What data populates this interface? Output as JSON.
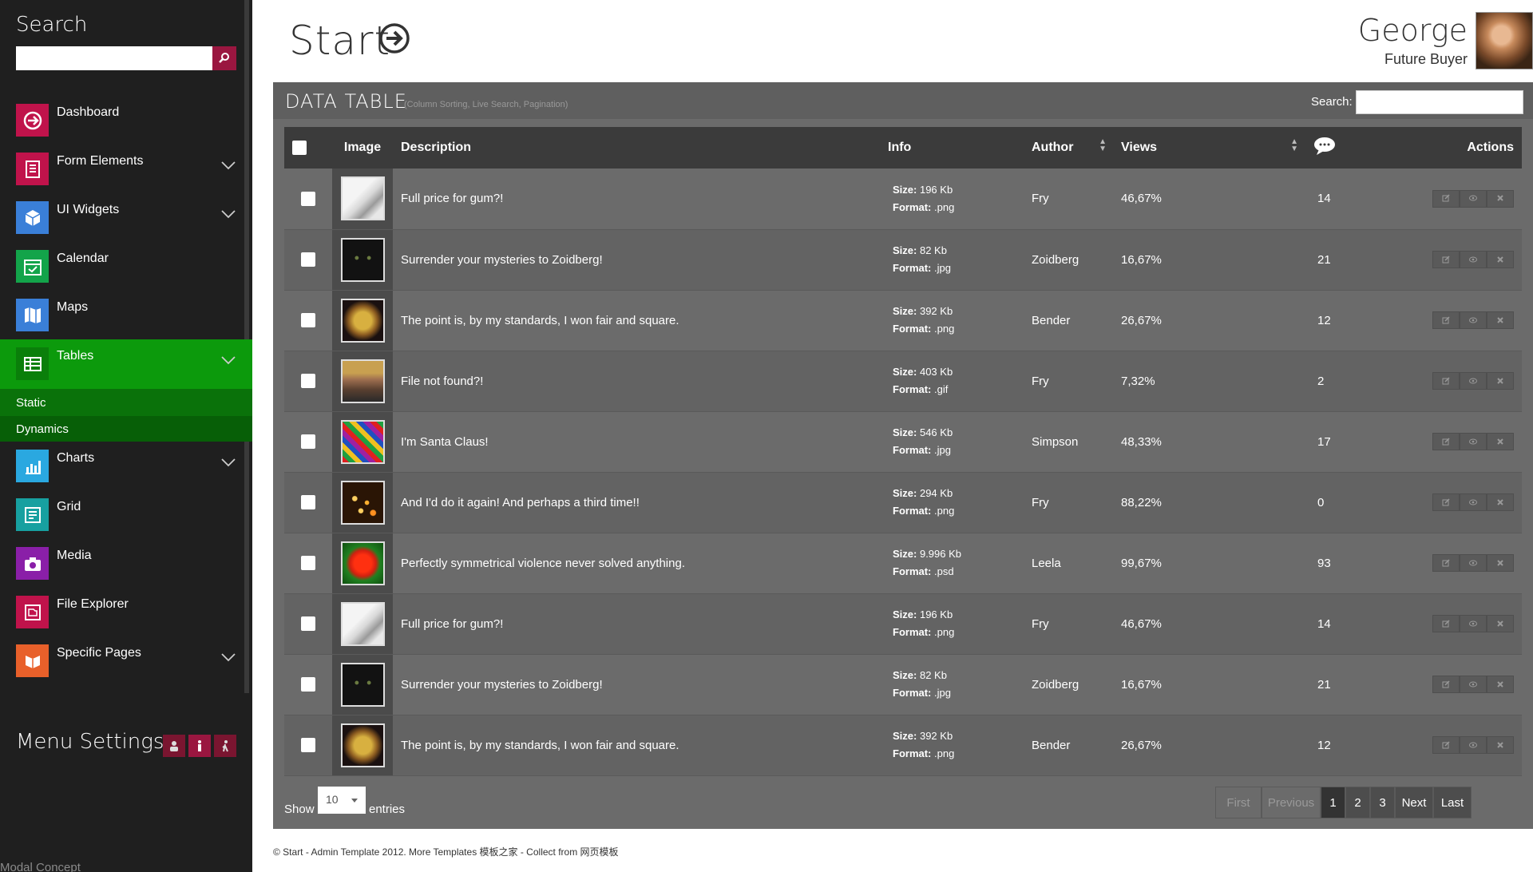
{
  "sidebar": {
    "search_label": "Search",
    "search_placeholder": "",
    "items": [
      {
        "label": "Dashboard",
        "color": "#c0134b",
        "icon": "arrow-circle-icon"
      },
      {
        "label": "Form Elements",
        "color": "#c0134b",
        "icon": "form-icon"
      },
      {
        "label": "UI Widgets",
        "color": "#3a7fd8",
        "icon": "cube-icon"
      },
      {
        "label": "Calendar",
        "color": "#13a44a",
        "icon": "calendar-icon"
      },
      {
        "label": "Maps",
        "color": "#3a7fd8",
        "icon": "map-icon"
      },
      {
        "label": "Tables",
        "color": "#0c9a0c",
        "icon": "table-icon"
      },
      {
        "label": "Charts",
        "color": "#2aa8e0",
        "icon": "chart-icon"
      },
      {
        "label": "Grid",
        "color": "#17a0a0",
        "icon": "grid-icon"
      },
      {
        "label": "Media",
        "color": "#8a1fa8",
        "icon": "camera-icon"
      },
      {
        "label": "File Explorer",
        "color": "#c0134b",
        "icon": "folder-icon"
      },
      {
        "label": "Specific Pages",
        "color": "#e8602a",
        "icon": "book-icon"
      }
    ],
    "sub_items": [
      "Static",
      "Dynamics"
    ],
    "menu_settings": "Menu Settings",
    "modal_concept": "Modal Concept"
  },
  "header": {
    "title": "Start",
    "user_name": "George",
    "user_role": "Future Buyer"
  },
  "panel": {
    "title": "DATA TABLE",
    "subtitle": "(Column Sorting, Live Search, Pagination)",
    "search_label": "Search:",
    "columns": [
      "Image",
      "Description",
      "Info",
      "Author",
      "Views",
      "Actions"
    ],
    "size_label": "Size:",
    "format_label": "Format:",
    "rows": [
      {
        "desc": "Full price for gum?!",
        "size": "196 Kb",
        "format": ".png",
        "author": "Fry",
        "views": "46,67%",
        "comments": "14",
        "thumb": "cat"
      },
      {
        "desc": "Surrender your mysteries to Zoidberg!",
        "size": "82 Kb",
        "format": ".jpg",
        "author": "Zoidberg",
        "views": "16,67%",
        "comments": "21",
        "thumb": "blackcat"
      },
      {
        "desc": "The point is, by my standards, I won fair and square.",
        "size": "392 Kb",
        "format": ".png",
        "author": "Bender",
        "views": "26,67%",
        "comments": "12",
        "thumb": "mask"
      },
      {
        "desc": "File not found?!",
        "size": "403 Kb",
        "format": ".gif",
        "author": "Fry",
        "views": "7,32%",
        "comments": "2",
        "thumb": "man"
      },
      {
        "desc": "I'm Santa Claus!",
        "size": "546 Kb",
        "format": ".jpg",
        "author": "Simpson",
        "views": "48,33%",
        "comments": "17",
        "thumb": "crayons"
      },
      {
        "desc": "And I'd do it again! And perhaps a third time!!",
        "size": "294 Kb",
        "format": ".png",
        "author": "Fry",
        "views": "88,22%",
        "comments": "0",
        "thumb": "candles"
      },
      {
        "desc": "Perfectly symmetrical violence never solved anything.",
        "size": "9.996 Kb",
        "format": ".psd",
        "author": "Leela",
        "views": "99,67%",
        "comments": "93",
        "thumb": "flower"
      },
      {
        "desc": "Full price for gum?!",
        "size": "196 Kb",
        "format": ".png",
        "author": "Fry",
        "views": "46,67%",
        "comments": "14",
        "thumb": "cat"
      },
      {
        "desc": "Surrender your mysteries to Zoidberg!",
        "size": "82 Kb",
        "format": ".jpg",
        "author": "Zoidberg",
        "views": "16,67%",
        "comments": "21",
        "thumb": "blackcat"
      },
      {
        "desc": "The point is, by my standards, I won fair and square.",
        "size": "392 Kb",
        "format": ".png",
        "author": "Bender",
        "views": "26,67%",
        "comments": "12",
        "thumb": "mask"
      }
    ],
    "show_label": "Show",
    "show_value": "10",
    "entries_label": "entries",
    "pager": [
      "First",
      "Previous",
      "1",
      "2",
      "3",
      "Next",
      "Last"
    ],
    "current_page": "1"
  },
  "footer": {
    "copyright": "© Start - Admin Template 2012. More Templates 模板之家 - Collect from 网页模板"
  }
}
